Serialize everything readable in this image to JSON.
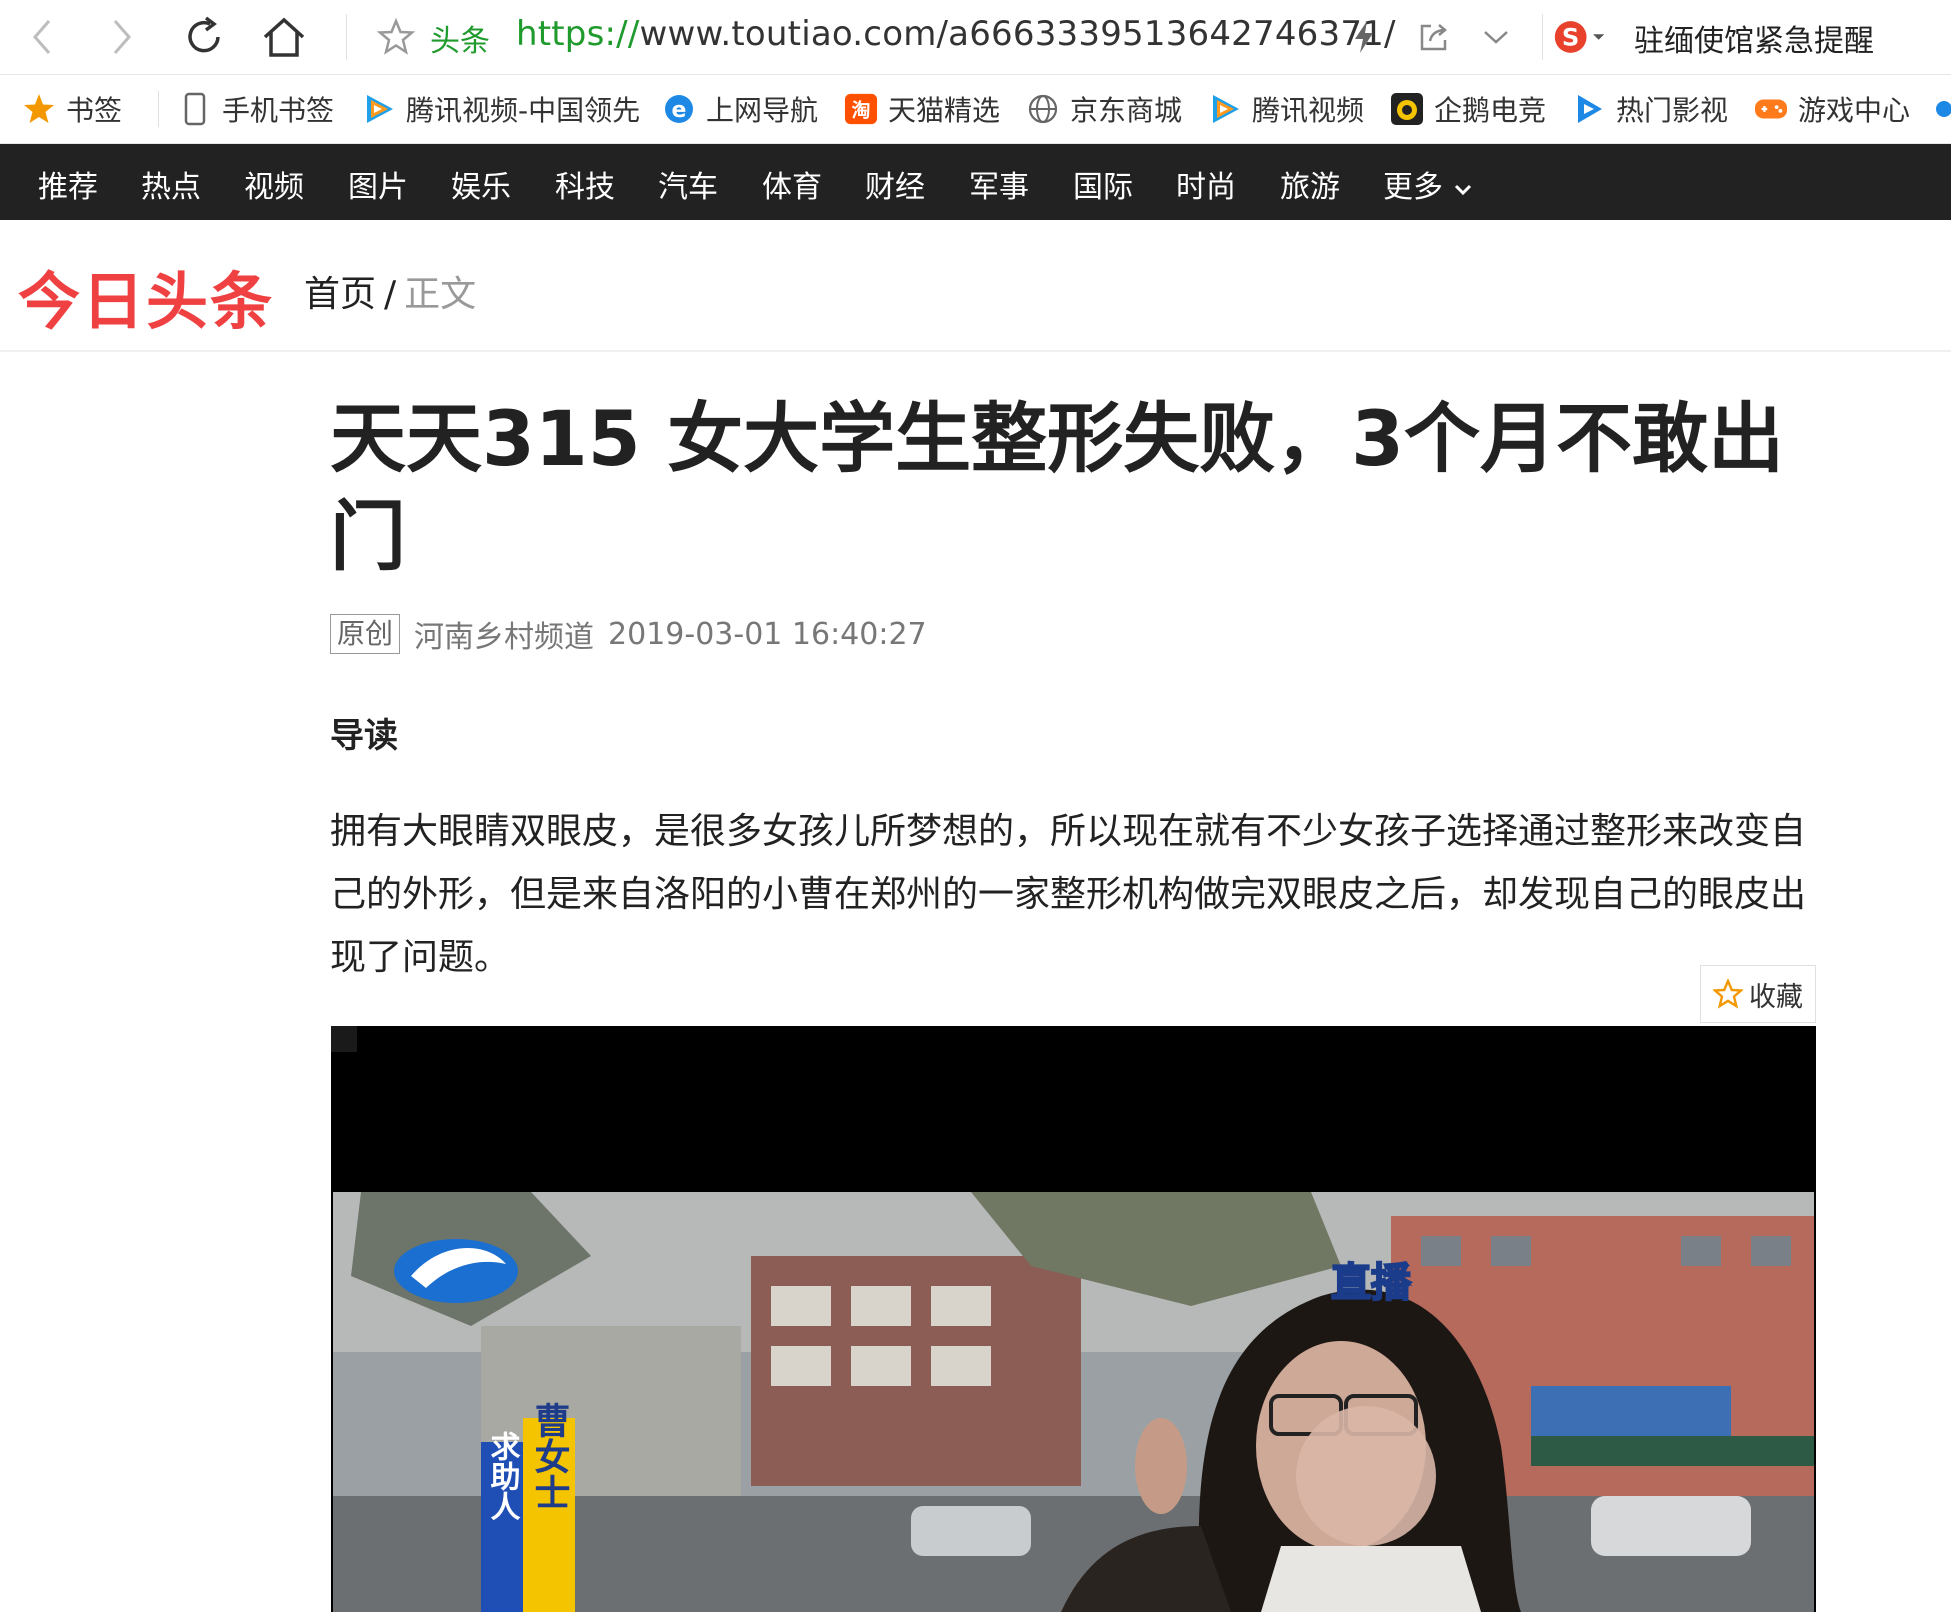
{
  "browser": {
    "site_label": "头条",
    "url_scheme": "https://",
    "url_rest": "www.toutiao.com/a6663339513642746371/",
    "alert_text": "驻缅使馆紧急提醒"
  },
  "bookmarks": [
    {
      "label": "书签",
      "icon": "star-icon"
    },
    {
      "label": "手机书签",
      "icon": "phone-icon"
    },
    {
      "label": "腾讯视频-中国领先",
      "icon": "tencent-video-icon"
    },
    {
      "label": "上网导航",
      "icon": "ie-icon"
    },
    {
      "label": "天猫精选",
      "icon": "taobao-icon"
    },
    {
      "label": "京东商城",
      "icon": "globe-icon"
    },
    {
      "label": "腾讯视频",
      "icon": "tencent-video-icon"
    },
    {
      "label": "企鹅电竞",
      "icon": "penguin-esports-icon"
    },
    {
      "label": "热门影视",
      "icon": "play-icon"
    },
    {
      "label": "游戏中心",
      "icon": "gamepad-icon"
    }
  ],
  "categories": [
    "推荐",
    "热点",
    "视频",
    "图片",
    "娱乐",
    "科技",
    "汽车",
    "体育",
    "财经",
    "军事",
    "国际",
    "时尚",
    "旅游",
    "更多"
  ],
  "site": {
    "logo": "今日头条",
    "breadcrumb_home": "首页",
    "breadcrumb_sep": "/",
    "breadcrumb_current": "正文"
  },
  "article": {
    "title": "天天315 女大学生整形失败，3个月不敢出门",
    "badge": "原创",
    "source": "河南乡村频道",
    "time": "2019-03-01 16:40:27",
    "lead_heading": "导读",
    "lead_text": "拥有大眼睛双眼皮，是很多女孩儿所梦想的，所以现在就有不少女孩子选择通过整形来改变自己的外形，但是来自洛阳的小曹在郑州的一家整形机构做完双眼皮之后，却发现自己的眼皮出现了问题。",
    "favorite_label": "收藏"
  },
  "video": {
    "live_label": "直播",
    "caption_tag": "求助人",
    "caption_name": "曹女士"
  },
  "colors": {
    "brand_red": "#f04142",
    "nav_bg": "#222222",
    "url_green": "#1f9a2c"
  }
}
